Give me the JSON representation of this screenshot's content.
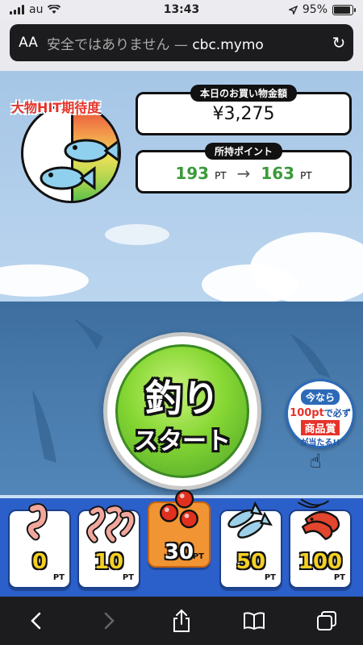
{
  "status": {
    "carrier": "au",
    "time": "13:43",
    "battery": "95%"
  },
  "browser": {
    "aa_label": "AA",
    "url_prefix": "安全ではありません — ",
    "url_host": "cbc.mymo"
  },
  "game": {
    "gauge_label": "大物HIT期待度",
    "purchase": {
      "label": "本日のお買い物金額",
      "amount": "¥3,275"
    },
    "points": {
      "label": "所持ポイント",
      "from": "193",
      "to": "163",
      "unit": "PT",
      "arrow": "→"
    },
    "start_button": {
      "line1": "釣り",
      "line2": "スタート"
    },
    "promo": {
      "line1": "今なら",
      "line2_value": "100pt",
      "line2_suffix": "で必ず",
      "line3": "商品賞",
      "line4": "が当たる!!"
    },
    "bait_options": [
      {
        "value": "0",
        "unit": "PT",
        "icon": "worm-icon"
      },
      {
        "value": "10",
        "unit": "PT",
        "icon": "worms-icon"
      },
      {
        "value": "30",
        "unit": "PT",
        "icon": "red-balls-icon",
        "selected": true
      },
      {
        "value": "50",
        "unit": "PT",
        "icon": "small-fish-icon"
      },
      {
        "value": "100",
        "unit": "PT",
        "icon": "shrimp-icon"
      }
    ]
  },
  "colors": {
    "accent_green": "#86d733",
    "bait_bar": "#2b5fc9",
    "selected_bait": "#f19433",
    "gauge_label": "#e6332a"
  }
}
